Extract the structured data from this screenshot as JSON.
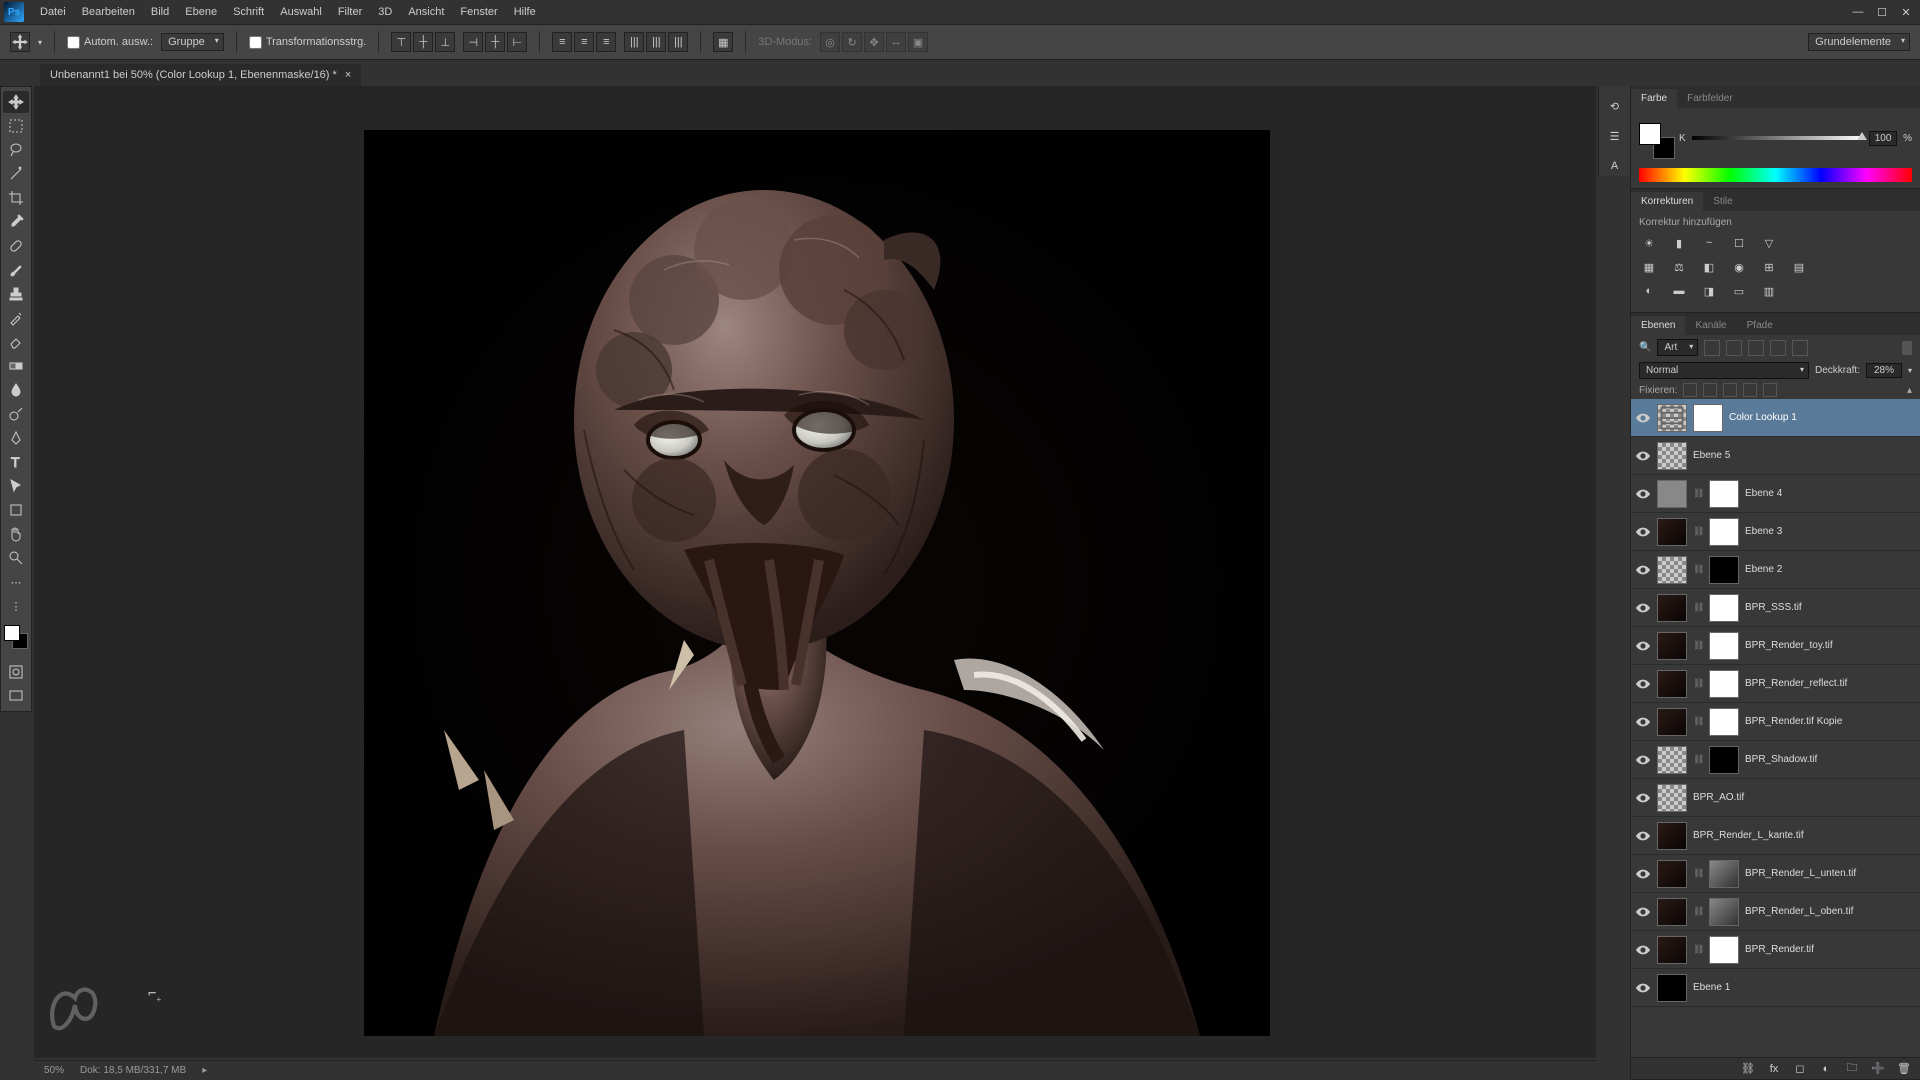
{
  "app": {
    "name": "Ps"
  },
  "menu": [
    "Datei",
    "Bearbeiten",
    "Bild",
    "Ebene",
    "Schrift",
    "Auswahl",
    "Filter",
    "3D",
    "Ansicht",
    "Fenster",
    "Hilfe"
  ],
  "options": {
    "auto_select": "Autom. ausw.:",
    "group": "Gruppe",
    "transform": "Transformationsstrg.",
    "mode3d": "3D-Modus:",
    "workspace": "Grundelemente"
  },
  "document": {
    "tab": "Unbenannt1 bei 50% (Color Lookup 1, Ebenenmaske/16) *"
  },
  "color_panel": {
    "tabs": [
      "Farbe",
      "Farbfelder"
    ],
    "channel": "K",
    "value": "100",
    "unit": "%"
  },
  "adjustments_panel": {
    "tabs": [
      "Korrekturen",
      "Stile"
    ],
    "hint": "Korrektur hinzufügen"
  },
  "layers_panel": {
    "tabs": [
      "Ebenen",
      "Kanäle",
      "Pfade"
    ],
    "filter_label": "Art",
    "blend_mode": "Normal",
    "opacity_label": "Deckkraft:",
    "opacity_value": "28%",
    "lock_label": "Fixieren:",
    "layers": [
      {
        "name": "Color Lookup 1",
        "selected": true,
        "thumb": "adj",
        "mask": "white"
      },
      {
        "name": "Ebene 5",
        "thumb": "checker"
      },
      {
        "name": "Ebene 4",
        "thumb": "gray",
        "mask": "white",
        "link": true
      },
      {
        "name": "Ebene 3",
        "thumb": "dark",
        "mask": "white",
        "link": true
      },
      {
        "name": "Ebene 2",
        "thumb": "checker",
        "mask": "black",
        "link": true
      },
      {
        "name": "BPR_SSS.tif",
        "thumb": "dark",
        "mask": "white",
        "link": true
      },
      {
        "name": "BPR_Render_toy.tif",
        "thumb": "dark",
        "mask": "white",
        "link": true
      },
      {
        "name": "BPR_Render_reflect.tif",
        "thumb": "dark",
        "mask": "white",
        "link": true
      },
      {
        "name": "BPR_Render.tif Kopie",
        "thumb": "dark",
        "mask": "white",
        "link": true
      },
      {
        "name": "BPR_Shadow.tif",
        "thumb": "checker",
        "mask": "black",
        "link": true
      },
      {
        "name": "BPR_AO.tif",
        "thumb": "checker"
      },
      {
        "name": "BPR_Render_L_kante.tif",
        "thumb": "dark"
      },
      {
        "name": "BPR_Render_L_unten.tif",
        "thumb": "dark",
        "mask": "gray",
        "link": true
      },
      {
        "name": "BPR_Render_L_oben.tif",
        "thumb": "dark",
        "mask": "gray",
        "link": true
      },
      {
        "name": "BPR_Render.tif",
        "thumb": "dark",
        "mask": "white",
        "link": true
      },
      {
        "name": "Ebene 1",
        "thumb": "black"
      }
    ]
  },
  "status": {
    "zoom": "50%",
    "doc_info": "Dok: 18,5 MB/331,7 MB"
  }
}
